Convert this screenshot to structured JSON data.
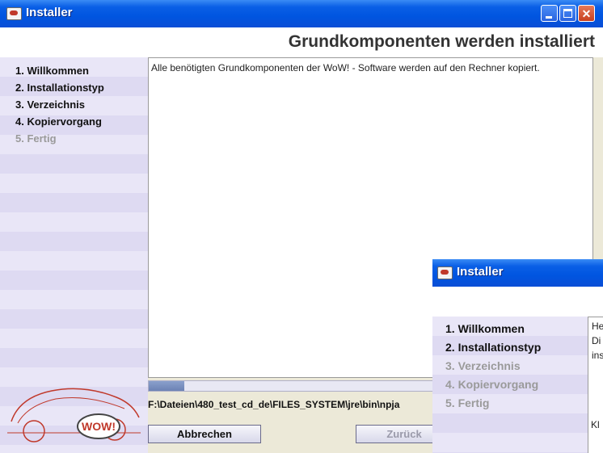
{
  "window": {
    "title": "Installer",
    "controls": [
      "minimize",
      "maximize",
      "close"
    ]
  },
  "header": {
    "title": "Grundkomponenten werden installiert"
  },
  "sidebar": {
    "steps": [
      {
        "label": "1. Willkommen",
        "state": "active"
      },
      {
        "label": "2. Installationstyp",
        "state": "active"
      },
      {
        "label": "3. Verzeichnis",
        "state": "active"
      },
      {
        "label": "4. Kopiervorgang",
        "state": "active"
      },
      {
        "label": "5. Fertig",
        "state": "inactive"
      }
    ]
  },
  "content": {
    "text": "Alle benötigten Grundkomponenten der WoW! - Software werden auf den Rechner kopiert."
  },
  "progress": {
    "fraction": 0.08
  },
  "status": {
    "path": "F:\\Dateien\\480_test_cd_de\\FILES_SYSTEM\\jre\\bin\\npja"
  },
  "buttons": {
    "cancel": "Abbrechen",
    "back": "Zurück"
  },
  "logo": {
    "text": "WOW!",
    "icon": "car-logo"
  },
  "second_window": {
    "title": "Installer",
    "steps": [
      {
        "label": "1. Willkommen",
        "state": "active"
      },
      {
        "label": "2. Installationstyp",
        "state": "active"
      },
      {
        "label": "3. Verzeichnis",
        "state": "inactive"
      },
      {
        "label": "4. Kopiervorgang",
        "state": "inactive"
      },
      {
        "label": "5. Fertig",
        "state": "inactive"
      }
    ],
    "content_lines": [
      "He",
      "Di",
      "ins"
    ],
    "bottom_text": "Kl"
  },
  "colors": {
    "titlebar": "#0055e0",
    "sidebar_light": "#e9e6f7",
    "sidebar_dark": "#dedaf2",
    "close_button": "#c8401f",
    "logo_red": "#c0392b"
  }
}
